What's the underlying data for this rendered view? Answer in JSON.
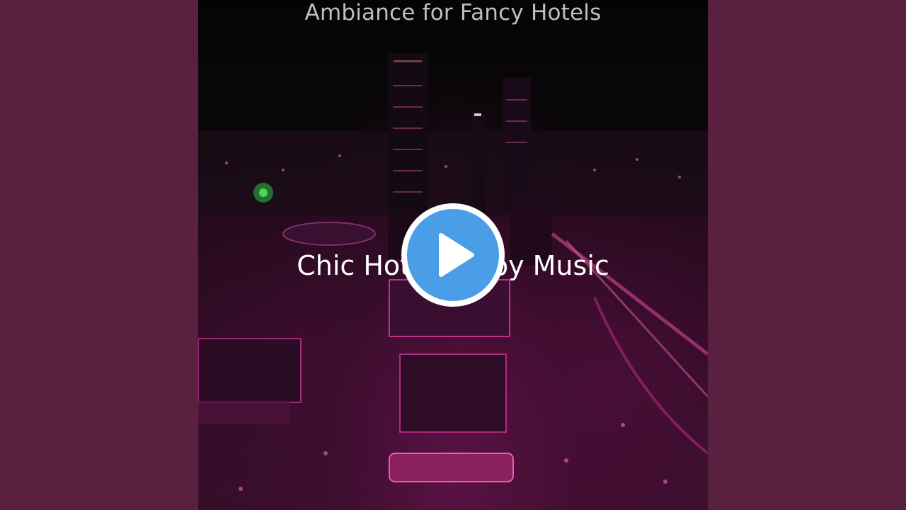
{
  "video": {
    "subtitle": "Ambiance for Fancy Hotels",
    "title": "Chic Hotel Lobby Music"
  },
  "player": {
    "play_icon": "play-icon",
    "accent_color": "#4a9ee8"
  },
  "colors": {
    "background": "#5a2040",
    "city_glow": "#d02896"
  }
}
